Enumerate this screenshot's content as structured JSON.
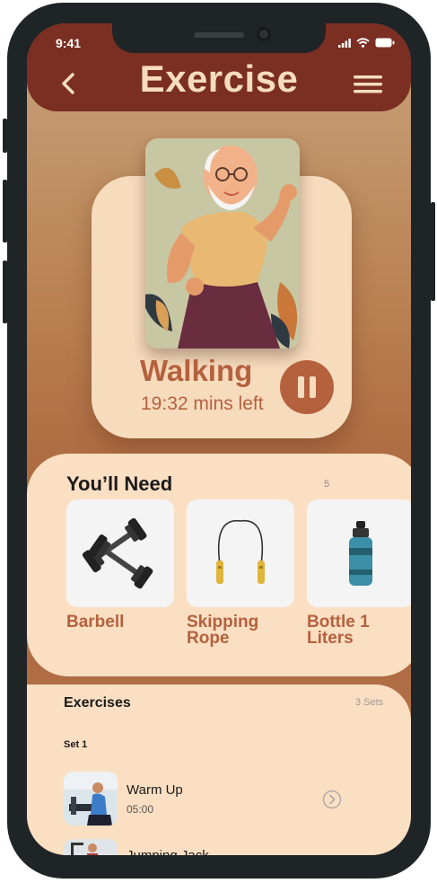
{
  "status": {
    "time": "9:41"
  },
  "header": {
    "title": "Exercise"
  },
  "current": {
    "name": "Walking",
    "time_left": "19:32 mins left"
  },
  "need": {
    "title": "You’ll Need",
    "side_small": "5",
    "items": [
      {
        "label_line1": "Barbell",
        "label_line2": "",
        "icon": "dumbbells-icon"
      },
      {
        "label_line1": "Skipping",
        "label_line2": "Rope",
        "icon": "jump-rope-icon"
      },
      {
        "label_line1": "Bottle 1",
        "label_line2": "Liters",
        "icon": "water-bottle-icon"
      }
    ]
  },
  "exercises": {
    "title": "Exercises",
    "sets": "3 Sets",
    "set_label": "Set 1",
    "rows": [
      {
        "name": "Warm Up",
        "time": "05:00"
      },
      {
        "name": "Jumping Jack",
        "time": ""
      }
    ]
  },
  "colors": {
    "header": "#7b2e22",
    "accent": "#b5613e",
    "card": "#f6dbbd"
  }
}
